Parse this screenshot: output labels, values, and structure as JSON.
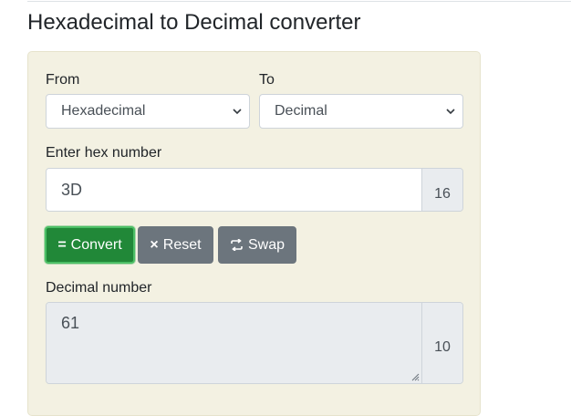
{
  "page": {
    "title": "Hexadecimal to Decimal converter"
  },
  "from": {
    "label": "From",
    "selected": "Hexadecimal"
  },
  "to": {
    "label": "To",
    "selected": "Decimal"
  },
  "input": {
    "label": "Enter hex number",
    "value": "3D",
    "base": "16"
  },
  "buttons": {
    "convert": {
      "icon": "=",
      "label": "Convert",
      "color": "#218838"
    },
    "reset": {
      "icon": "×",
      "label": "Reset",
      "color": "#6c757d"
    },
    "swap": {
      "icon": "swap-icon",
      "label": "Swap",
      "color": "#6c757d"
    }
  },
  "output": {
    "label": "Decimal number",
    "value": "61",
    "base": "10"
  },
  "icons": [
    "chevron-down-icon",
    "times-icon",
    "swap-icon",
    "resize-grip-icon"
  ]
}
